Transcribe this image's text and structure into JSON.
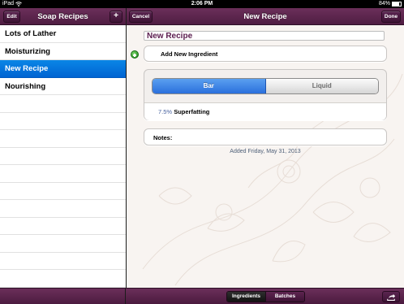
{
  "status_bar": {
    "device": "iPad",
    "time": "2:06 PM",
    "battery": "84%",
    "battery_level": 0.84
  },
  "left_nav": {
    "edit_label": "Edit",
    "title": "Soap Recipes",
    "add_label": "+"
  },
  "recipes": [
    {
      "name": "Lots of Lather",
      "selected": false
    },
    {
      "name": "Moisturizing",
      "selected": false
    },
    {
      "name": "New Recipe",
      "selected": true
    },
    {
      "name": "Nourishing",
      "selected": false
    }
  ],
  "right_nav": {
    "cancel_label": "Cancel",
    "title": "New Recipe",
    "done_label": "Done"
  },
  "detail": {
    "recipe_name": "New Recipe",
    "add_ingredient_label": "Add New Ingredient",
    "type_options": [
      "Bar",
      "Liquid"
    ],
    "selected_type": "Bar",
    "superfat_value": "7.5%",
    "superfat_label": "Superfatting",
    "notes_label": "Notes:",
    "added_text": "Added Friday, May 31, 2013"
  },
  "bottom_bar": {
    "tabs": [
      "Ingredients",
      "Batches"
    ],
    "selected_tab": "Ingredients",
    "share_icon": "share-icon"
  },
  "colors": {
    "toolbar": "#5a2550",
    "selection": "#0a78e0",
    "title_text": "#5a1c4e",
    "segment_on": "#3a80e6"
  }
}
